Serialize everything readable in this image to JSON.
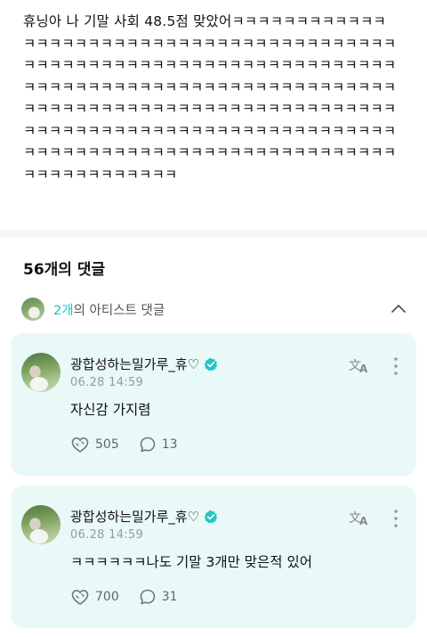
{
  "post": {
    "body": "휴닝아 나 기말 사회 48.5점 맞았어ㅋㅋㅋㅋㅋㅋㅋㅋㅋㅋㅋㅋㅋㅋㅋㅋㅋㅋㅋㅋㅋㅋㅋㅋㅋㅋㅋㅋㅋㅋㅋㅋㅋㅋㅋㅋㅋㅋㅋㅋㅋㅋㅋㅋㅋㅋㅋㅋㅋㅋㅋㅋㅋㅋㅋㅋㅋㅋㅋㅋㅋㅋㅋㅋㅋㅋㅋㅋㅋㅋㅋㅋㅋㅋㅋㅋㅋㅋㅋㅋㅋㅋㅋㅋㅋㅋㅋㅋㅋㅋㅋㅋㅋㅋㅋㅋㅋㅋㅋㅋㅋㅋㅋㅋㅋㅋㅋㅋㅋㅋㅋㅋㅋㅋㅋㅋㅋㅋㅋㅋㅋㅋㅋㅋㅋㅋㅋㅋㅋㅋㅋㅋㅋㅋㅋㅋㅋㅋㅋㅋㅋㅋㅋㅋㅋㅋㅋㅋㅋㅋㅋㅋㅋㅋㅋㅋㅋㅋㅋㅋㅋㅋㅋㅋㅋㅋㅋㅋㅋㅋㅋㅋㅋㅋㅋㅋㅋㅋㅋㅋㅋㅋㅋㅋㅋㅋㅋㅋㅋㅋㅋㅋㅋㅋㅋㅋㅋㅋ"
  },
  "comments_header": {
    "count_label": "56개의 댓글"
  },
  "artist_comments": {
    "count": "2개",
    "suffix": "의 아티스트 댓글"
  },
  "comments": [
    {
      "author": "광합성하는밀가루_휴♡",
      "timestamp": "06.28 14:59",
      "text": "자신감 가지렴",
      "likes": "505",
      "replies": "13"
    },
    {
      "author": "광합성하는밀가루_휴♡",
      "timestamp": "06.28 14:59",
      "text": "ㅋㅋㅋㅋㅋㅋ나도 기말 3개만 맞은적 있어",
      "likes": "700",
      "replies": "31"
    }
  ],
  "colors": {
    "accent": "#1fc5c0",
    "card_bg": "#e9f9f7",
    "verified": "#27c4c0"
  },
  "icons": [
    "chevron-up-icon",
    "verified-badge-icon",
    "translate-icon",
    "more-vertical-icon",
    "like-icon",
    "reply-icon"
  ]
}
